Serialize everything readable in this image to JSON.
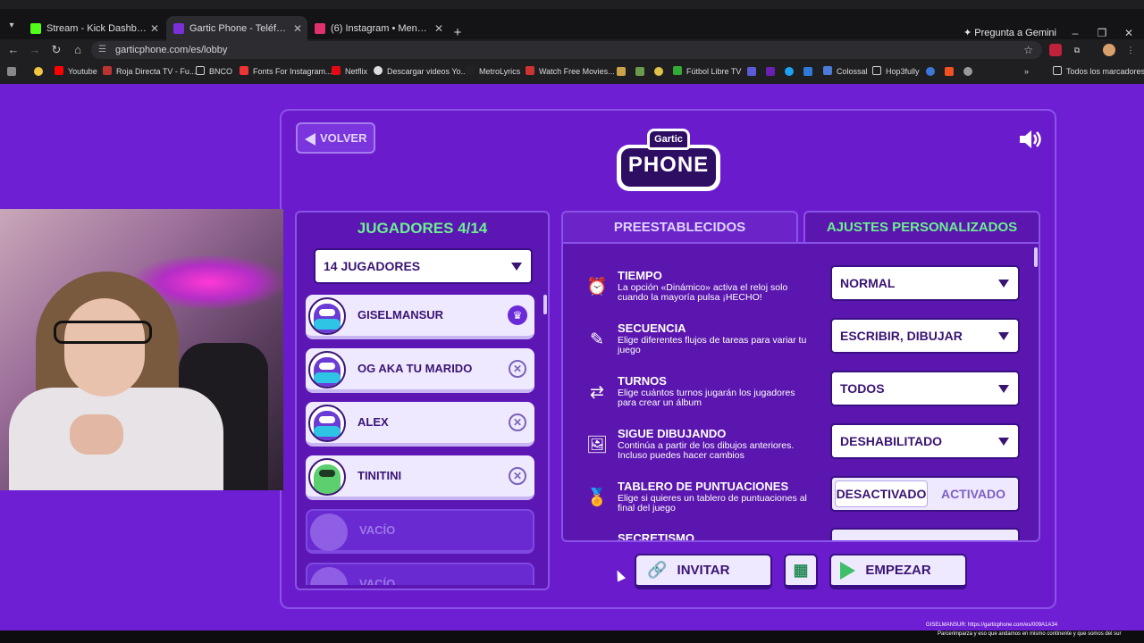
{
  "browser": {
    "tabs": [
      {
        "label": "Stream - Kick Dashboard",
        "color": "#53fc18"
      },
      {
        "label": "Gartic Phone - Teléfono Descon",
        "color": "#7b2fd8"
      },
      {
        "label": "(6) Instagram • Mensajes",
        "color": "#e1306c"
      }
    ],
    "gemini": "Pregunta a Gemini",
    "url": "garticphone.com/es/lobby",
    "bookmarks": [
      "Youtube",
      "Roja Directa TV - Fu...",
      "BNCO",
      "Fonts For Instagram...",
      "Netflix",
      "Descargar videos Yo...",
      "MetroLyrics",
      "Watch Free Movies...",
      "Fútbol Libre TV",
      "Colossal",
      "Hop3fully"
    ],
    "all_bookmarks": "Todos los marcadores"
  },
  "game": {
    "back_label": "VOLVER",
    "logo_top": "Gartic",
    "logo_bottom": "PHONE",
    "players_title": "JUGADORES 4/14",
    "players_select": "14 JUGADORES",
    "players": [
      {
        "name": "GISELMANSUR",
        "role": "host"
      },
      {
        "name": "OG AKA TU MARIDO",
        "role": "player"
      },
      {
        "name": "ALEX",
        "role": "player"
      },
      {
        "name": "TINITINI",
        "role": "player"
      }
    ],
    "empty_label": "VACÍO",
    "tab_presets": "PREESTABLECIDOS",
    "tab_custom": "AJUSTES PERSONALIZADOS",
    "settings": [
      {
        "title": "TIEMPO",
        "desc": "La opción «Dinámico» activa el reloj solo cuando la mayoría pulsa ¡HECHO!",
        "value": "NORMAL",
        "icon": "clock-icon"
      },
      {
        "title": "SECUENCIA",
        "desc": "Elige diferentes flujos de tareas para variar tu juego",
        "value": "ESCRIBIR, DIBUJAR",
        "icon": "pen-bubble-icon"
      },
      {
        "title": "TURNOS",
        "desc": "Elige cuántos turnos jugarán los jugadores para crear un álbum",
        "value": "TODOS",
        "icon": "turns-icon"
      },
      {
        "title": "SIGUE DIBUJANDO",
        "desc": "Continúa a partir de los dibujos anteriores. Incluso puedes hacer cambios",
        "value": "DESHABILITADO",
        "icon": "image-pen-icon"
      },
      {
        "title": "TABLERO DE PUNTUACIONES",
        "desc": "Elige si quieres un tablero de puntuaciones al final del juego",
        "toggle_off": "DESACTIVADO",
        "toggle_on": "ACTIVADO",
        "icon": "medal-icon"
      },
      {
        "title": "SECRETISMO",
        "icon": "secret-icon"
      }
    ],
    "invite_label": "INVITAR",
    "start_label": "EMPEZAR"
  },
  "overlay": {
    "line1": "GISELMANSUR: https://garticphone.com/es/009A1A34",
    "line2": "Parcerimparza y eso que andamos en mismo continente y que somos del sur"
  }
}
